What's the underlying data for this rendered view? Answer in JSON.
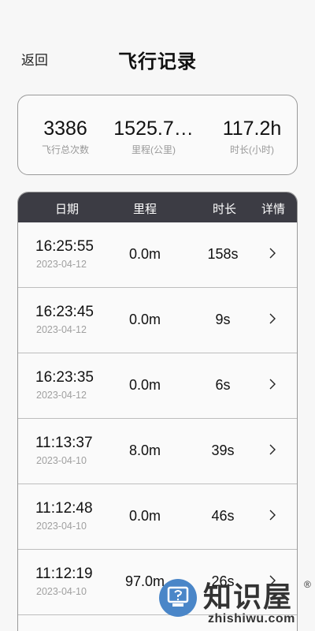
{
  "header": {
    "back_label": "返回",
    "title": "飞行记录"
  },
  "summary": {
    "count_value": "3386",
    "count_label": "飞行总次数",
    "distance_value": "1525.7…",
    "distance_label": "里程(公里)",
    "duration_value": "117.2h",
    "duration_label": "时长(小时)"
  },
  "table": {
    "headers": {
      "date": "日期",
      "distance": "里程",
      "duration": "时长",
      "detail": "详情"
    },
    "rows": [
      {
        "time": "16:25:55",
        "date": "2023-04-12",
        "distance": "0.0m",
        "duration": "158s"
      },
      {
        "time": "16:23:45",
        "date": "2023-04-12",
        "distance": "0.0m",
        "duration": "9s"
      },
      {
        "time": "16:23:35",
        "date": "2023-04-12",
        "distance": "0.0m",
        "duration": "6s"
      },
      {
        "time": "11:13:37",
        "date": "2023-04-10",
        "distance": "8.0m",
        "duration": "39s"
      },
      {
        "time": "11:12:48",
        "date": "2023-04-10",
        "distance": "0.0m",
        "duration": "46s"
      },
      {
        "time": "11:12:19",
        "date": "2023-04-10",
        "distance": "97.0m",
        "duration": "26s"
      }
    ],
    "row_icon": "chevron-right-icon"
  },
  "watermark": {
    "brand": "知识屋",
    "reg_mark": "®",
    "url": "zhishiwu.com",
    "icon": "question-monitor-icon",
    "accent": "#4a86c8"
  }
}
